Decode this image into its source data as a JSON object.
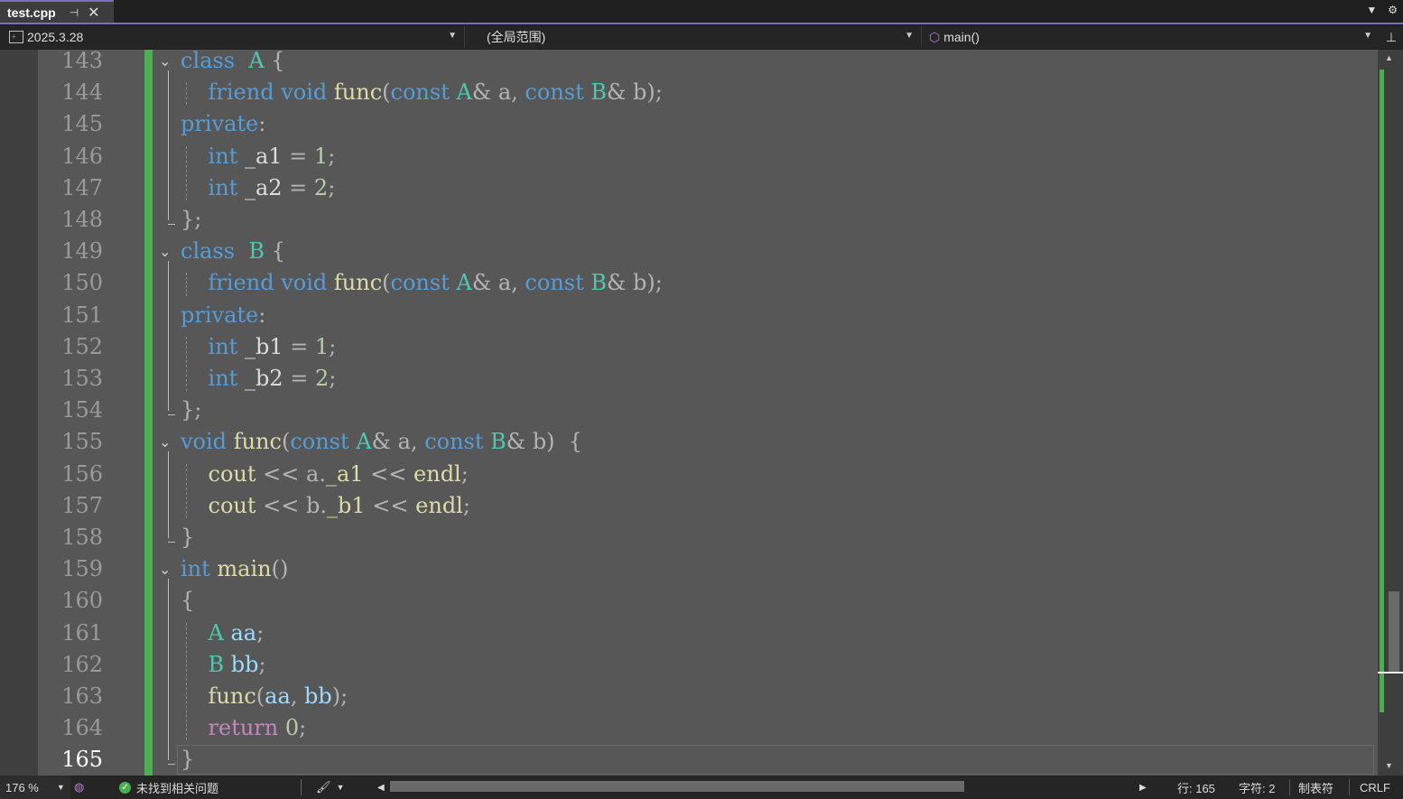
{
  "tab": {
    "title": "test.cpp",
    "pin_icon": "pin-icon",
    "close_icon": "close-icon"
  },
  "navbar": {
    "project": "2025.3.28",
    "scope": "(全局范围)",
    "member": "main()"
  },
  "editor": {
    "first_line": 143,
    "current_line": 165,
    "lines": [
      {
        "n": "143"
      },
      {
        "n": "144"
      },
      {
        "n": "145"
      },
      {
        "n": "146"
      },
      {
        "n": "147"
      },
      {
        "n": "148"
      },
      {
        "n": "149"
      },
      {
        "n": "150"
      },
      {
        "n": "151"
      },
      {
        "n": "152"
      },
      {
        "n": "153"
      },
      {
        "n": "154"
      },
      {
        "n": "155"
      },
      {
        "n": "156"
      },
      {
        "n": "157"
      },
      {
        "n": "158"
      },
      {
        "n": "159"
      },
      {
        "n": "160"
      },
      {
        "n": "161"
      },
      {
        "n": "162"
      },
      {
        "n": "163"
      },
      {
        "n": "164"
      },
      {
        "n": "165"
      }
    ],
    "code": [
      [
        [
          "kw",
          "class"
        ],
        [
          "",
          "  "
        ],
        [
          "ty",
          "A"
        ],
        [
          "pn",
          " {"
        ]
      ],
      [
        [
          "",
          "    "
        ],
        [
          "kw",
          "friend"
        ],
        [
          "",
          " "
        ],
        [
          "kw",
          "void"
        ],
        [
          "",
          " "
        ],
        [
          "fn",
          "func"
        ],
        [
          "pn",
          "("
        ],
        [
          "kw",
          "const"
        ],
        [
          "",
          " "
        ],
        [
          "ty",
          "A"
        ],
        [
          "pn",
          "&"
        ],
        [
          "",
          " "
        ],
        [
          "pn",
          "a,"
        ],
        [
          "",
          " "
        ],
        [
          "kw",
          "const"
        ],
        [
          "",
          " "
        ],
        [
          "ty",
          "B"
        ],
        [
          "pn",
          "&"
        ],
        [
          "",
          " "
        ],
        [
          "pn",
          "b);"
        ]
      ],
      [
        [
          "kw",
          "private"
        ],
        [
          "pn",
          ":"
        ]
      ],
      [
        [
          "",
          "    "
        ],
        [
          "kw",
          "int"
        ],
        [
          "",
          " "
        ],
        [
          "",
          "_a1"
        ],
        [
          "",
          " "
        ],
        [
          "pn",
          "="
        ],
        [
          "",
          " "
        ],
        [
          "nu",
          "1"
        ],
        [
          "pn",
          ";"
        ]
      ],
      [
        [
          "",
          "    "
        ],
        [
          "kw",
          "int"
        ],
        [
          "",
          " "
        ],
        [
          "",
          "_a2"
        ],
        [
          "",
          " "
        ],
        [
          "pn",
          "="
        ],
        [
          "",
          " "
        ],
        [
          "nu",
          "2"
        ],
        [
          "pn",
          ";"
        ]
      ],
      [
        [
          "pn",
          "};"
        ]
      ],
      [
        [
          "kw",
          "class"
        ],
        [
          "",
          "  "
        ],
        [
          "ty",
          "B"
        ],
        [
          "pn",
          " {"
        ]
      ],
      [
        [
          "",
          "    "
        ],
        [
          "kw",
          "friend"
        ],
        [
          "",
          " "
        ],
        [
          "kw",
          "void"
        ],
        [
          "",
          " "
        ],
        [
          "fn",
          "func"
        ],
        [
          "pn",
          "("
        ],
        [
          "kw",
          "const"
        ],
        [
          "",
          " "
        ],
        [
          "ty",
          "A"
        ],
        [
          "pn",
          "&"
        ],
        [
          "",
          " "
        ],
        [
          "pn",
          "a,"
        ],
        [
          "",
          " "
        ],
        [
          "kw",
          "const"
        ],
        [
          "",
          " "
        ],
        [
          "ty",
          "B"
        ],
        [
          "pn",
          "&"
        ],
        [
          "",
          " "
        ],
        [
          "pn",
          "b);"
        ]
      ],
      [
        [
          "kw",
          "private"
        ],
        [
          "pn",
          ":"
        ]
      ],
      [
        [
          "",
          "    "
        ],
        [
          "kw",
          "int"
        ],
        [
          "",
          " "
        ],
        [
          "",
          "_b1"
        ],
        [
          "",
          " "
        ],
        [
          "pn",
          "="
        ],
        [
          "",
          " "
        ],
        [
          "nu",
          "1"
        ],
        [
          "pn",
          ";"
        ]
      ],
      [
        [
          "",
          "    "
        ],
        [
          "kw",
          "int"
        ],
        [
          "",
          " "
        ],
        [
          "",
          "_b2"
        ],
        [
          "",
          " "
        ],
        [
          "pn",
          "="
        ],
        [
          "",
          " "
        ],
        [
          "nu",
          "2"
        ],
        [
          "pn",
          ";"
        ]
      ],
      [
        [
          "pn",
          "};"
        ]
      ],
      [
        [
          "kw",
          "void"
        ],
        [
          "",
          " "
        ],
        [
          "fn",
          "func"
        ],
        [
          "pn",
          "("
        ],
        [
          "kw",
          "const"
        ],
        [
          "",
          " "
        ],
        [
          "ty",
          "A"
        ],
        [
          "pn",
          "&"
        ],
        [
          "",
          " "
        ],
        [
          "pn",
          "a,"
        ],
        [
          "",
          " "
        ],
        [
          "kw",
          "const"
        ],
        [
          "",
          " "
        ],
        [
          "ty",
          "B"
        ],
        [
          "pn",
          "&"
        ],
        [
          "",
          " "
        ],
        [
          "pn",
          "b)"
        ],
        [
          "pn",
          "  {"
        ]
      ],
      [
        [
          "",
          "    "
        ],
        [
          "fn",
          "cout"
        ],
        [
          "",
          " "
        ],
        [
          "pn",
          "<<"
        ],
        [
          "",
          " "
        ],
        [
          "pn",
          "a."
        ],
        [
          "fn",
          "_a1"
        ],
        [
          "",
          " "
        ],
        [
          "pn",
          "<<"
        ],
        [
          "",
          " "
        ],
        [
          "fn",
          "endl"
        ],
        [
          "pn",
          ";"
        ]
      ],
      [
        [
          "",
          "    "
        ],
        [
          "fn",
          "cout"
        ],
        [
          "",
          " "
        ],
        [
          "pn",
          "<<"
        ],
        [
          "",
          " "
        ],
        [
          "pn",
          "b."
        ],
        [
          "fn",
          "_b1"
        ],
        [
          "",
          " "
        ],
        [
          "pn",
          "<<"
        ],
        [
          "",
          " "
        ],
        [
          "fn",
          "endl"
        ],
        [
          "pn",
          ";"
        ]
      ],
      [
        [
          "pn",
          "}"
        ]
      ],
      [
        [
          "kw",
          "int"
        ],
        [
          "",
          " "
        ],
        [
          "fn",
          "main"
        ],
        [
          "pn",
          "()"
        ]
      ],
      [
        [
          "pn",
          "{"
        ]
      ],
      [
        [
          "",
          "    "
        ],
        [
          "ty",
          "A"
        ],
        [
          "",
          " "
        ],
        [
          "pr",
          "aa"
        ],
        [
          "pn",
          ";"
        ]
      ],
      [
        [
          "",
          "    "
        ],
        [
          "ty",
          "B"
        ],
        [
          "",
          " "
        ],
        [
          "pr",
          "bb"
        ],
        [
          "pn",
          ";"
        ]
      ],
      [
        [
          "",
          "    "
        ],
        [
          "fn",
          "func"
        ],
        [
          "pn",
          "("
        ],
        [
          "pr",
          "aa"
        ],
        [
          "pn",
          ","
        ],
        [
          "",
          " "
        ],
        [
          "pr",
          "bb"
        ],
        [
          "pn",
          ");"
        ]
      ],
      [
        [
          "",
          "    "
        ],
        [
          "ct",
          "return"
        ],
        [
          "",
          " "
        ],
        [
          "nu",
          "0"
        ],
        [
          "pn",
          ";"
        ]
      ],
      [
        [
          "pn",
          "}"
        ]
      ]
    ]
  },
  "status": {
    "zoom": "176 %",
    "issues": "未找到相关问题",
    "line": "行: 165",
    "char": "字符: 2",
    "indent": "制表符",
    "eol": "CRLF"
  },
  "colors": {
    "accent": "#7b6cc7",
    "changebar": "#4caf50",
    "editor_bg": "#575757"
  }
}
